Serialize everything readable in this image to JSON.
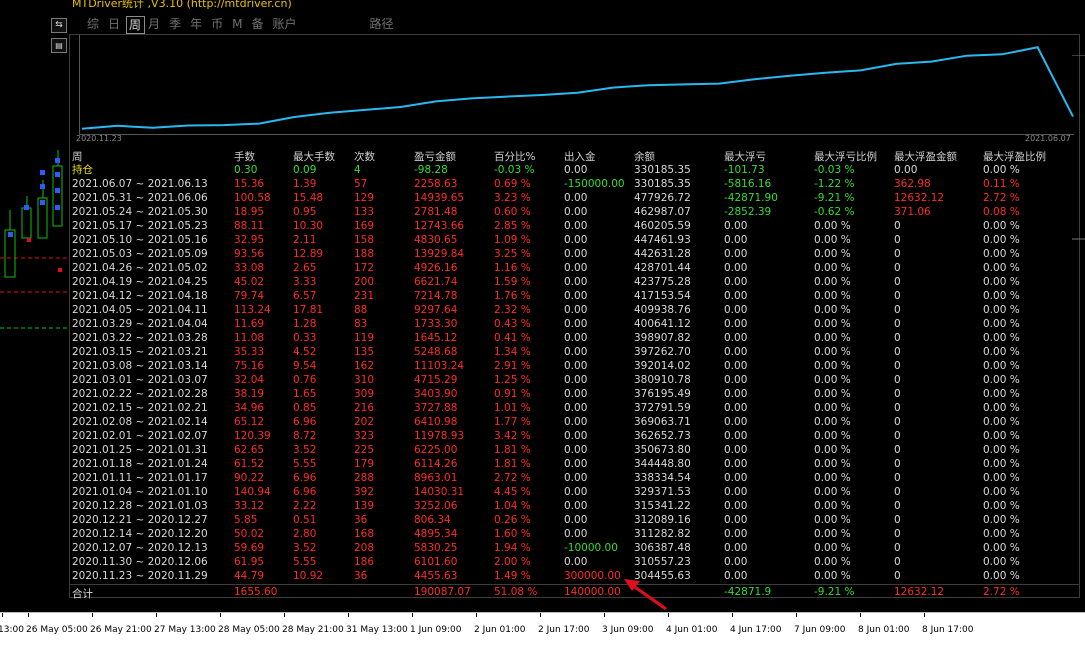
{
  "window": {
    "title": "MTDriver统计 ,V3.10 (http://mtdriver.cn)"
  },
  "side_buttons": [
    "⇆",
    "▤",
    "√"
  ],
  "tabs": [
    {
      "label": "综"
    },
    {
      "label": "日"
    },
    {
      "label": "周",
      "active": true
    },
    {
      "label": "月"
    },
    {
      "label": "季"
    },
    {
      "label": "年"
    },
    {
      "label": "币"
    },
    {
      "label": "M"
    },
    {
      "label": "备"
    },
    {
      "label": "账户"
    },
    {
      "label": "路径"
    }
  ],
  "equity_chart": {
    "start_date": "2020.11.23",
    "end_date": "2021.06.07",
    "line_color": "#2ab8f0",
    "balances": [
      304455.63,
      310557.23,
      306387.48,
      311282.82,
      312089.16,
      315341.22,
      329371.53,
      338334.54,
      344448.8,
      350673.8,
      362652.73,
      369063.71,
      372791.59,
      376195.49,
      380910.78,
      392014.02,
      397262.7,
      398907.82,
      400641.12,
      409938.76,
      417153.54,
      423775.28,
      428701.44,
      442631.28,
      447461.93,
      460205.59,
      462987.07,
      477926.72,
      330185.35
    ]
  },
  "table": {
    "headers": [
      "周",
      "手数",
      "最大手数",
      "次数",
      "盈亏金额",
      "百分比%",
      "出入金",
      "余额",
      "最大浮亏",
      "最大浮亏比例",
      "最大浮盈金额",
      "最大浮盈比例"
    ],
    "holding": {
      "label": "持仓",
      "cells": [
        {
          "v": "0.30",
          "c": "g"
        },
        {
          "v": "0.09",
          "c": "g"
        },
        {
          "v": "4",
          "c": "g"
        },
        {
          "v": "-98.28",
          "c": "g"
        },
        {
          "v": "-0.03 %",
          "c": "g"
        },
        {
          "v": "0.00",
          "c": "w"
        },
        {
          "v": "330185.35",
          "c": "w"
        },
        {
          "v": "-101.73",
          "c": "g"
        },
        {
          "v": "-0.03 %",
          "c": "g"
        },
        {
          "v": "0.00",
          "c": "w"
        },
        {
          "v": "0.00 %",
          "c": "w"
        }
      ]
    },
    "rows": [
      [
        "2021.06.07 ~ 2021.06.13",
        "15.36",
        "1.39",
        "57",
        "2258.63",
        "0.69 %",
        "-150000.00",
        "330185.35",
        "-5816.16",
        "-1.22 %",
        "362.98",
        "0.11 %"
      ],
      [
        "2021.05.31 ~ 2021.06.06",
        "100.58",
        "15.48",
        "129",
        "14939.65",
        "3.23 %",
        "0.00",
        "477926.72",
        "-42871.90",
        "-9.21 %",
        "12632.12",
        "2.72 %"
      ],
      [
        "2021.05.24 ~ 2021.05.30",
        "18.95",
        "0.95",
        "133",
        "2781.48",
        "0.60 %",
        "0.00",
        "462987.07",
        "-2852.39",
        "-0.62 %",
        "371.06",
        "0.08 %"
      ],
      [
        "2021.05.17 ~ 2021.05.23",
        "88.11",
        "10.30",
        "169",
        "12743.66",
        "2.85 %",
        "0.00",
        "460205.59",
        "0.00",
        "0.00 %",
        "0",
        "0.00 %"
      ],
      [
        "2021.05.10 ~ 2021.05.16",
        "32.95",
        "2.11",
        "158",
        "4830.65",
        "1.09 %",
        "0.00",
        "447461.93",
        "0.00",
        "0.00 %",
        "0",
        "0.00 %"
      ],
      [
        "2021.05.03 ~ 2021.05.09",
        "93.56",
        "12.89",
        "188",
        "13929.84",
        "3.25 %",
        "0.00",
        "442631.28",
        "0.00",
        "0.00 %",
        "0",
        "0.00 %"
      ],
      [
        "2021.04.26 ~ 2021.05.02",
        "33.08",
        "2.65",
        "172",
        "4926.16",
        "1.16 %",
        "0.00",
        "428701.44",
        "0.00",
        "0.00 %",
        "0",
        "0.00 %"
      ],
      [
        "2021.04.19 ~ 2021.04.25",
        "45.02",
        "3.33",
        "200",
        "6621.74",
        "1.59 %",
        "0.00",
        "423775.28",
        "0.00",
        "0.00 %",
        "0",
        "0.00 %"
      ],
      [
        "2021.04.12 ~ 2021.04.18",
        "79.74",
        "6.57",
        "231",
        "7214.78",
        "1.76 %",
        "0.00",
        "417153.54",
        "0.00",
        "0.00 %",
        "0",
        "0.00 %"
      ],
      [
        "2021.04.05 ~ 2021.04.11",
        "113.24",
        "17.81",
        "88",
        "9297.64",
        "2.32 %",
        "0.00",
        "409938.76",
        "0.00",
        "0.00 %",
        "0",
        "0.00 %"
      ],
      [
        "2021.03.29 ~ 2021.04.04",
        "11.69",
        "1.28",
        "83",
        "1733.30",
        "0.43 %",
        "0.00",
        "400641.12",
        "0.00",
        "0.00 %",
        "0",
        "0.00 %"
      ],
      [
        "2021.03.22 ~ 2021.03.28",
        "11.08",
        "0.33",
        "119",
        "1645.12",
        "0.41 %",
        "0.00",
        "398907.82",
        "0.00",
        "0.00 %",
        "0",
        "0.00 %"
      ],
      [
        "2021.03.15 ~ 2021.03.21",
        "35.33",
        "4.52",
        "135",
        "5248.68",
        "1.34 %",
        "0.00",
        "397262.70",
        "0.00",
        "0.00 %",
        "0",
        "0.00 %"
      ],
      [
        "2021.03.08 ~ 2021.03.14",
        "75.16",
        "9.54",
        "162",
        "11103.24",
        "2.91 %",
        "0.00",
        "392014.02",
        "0.00",
        "0.00 %",
        "0",
        "0.00 %"
      ],
      [
        "2021.03.01 ~ 2021.03.07",
        "32.04",
        "0.76",
        "310",
        "4715.29",
        "1.25 %",
        "0.00",
        "380910.78",
        "0.00",
        "0.00 %",
        "0",
        "0.00 %"
      ],
      [
        "2021.02.22 ~ 2021.02.28",
        "38.19",
        "1.65",
        "309",
        "3403.90",
        "0.91 %",
        "0.00",
        "376195.49",
        "0.00",
        "0.00 %",
        "0",
        "0.00 %"
      ],
      [
        "2021.02.15 ~ 2021.02.21",
        "34.96",
        "0.85",
        "216",
        "3727.88",
        "1.01 %",
        "0.00",
        "372791.59",
        "0.00",
        "0.00 %",
        "0",
        "0.00 %"
      ],
      [
        "2021.02.08 ~ 2021.02.14",
        "65.12",
        "6.96",
        "202",
        "6410.98",
        "1.77 %",
        "0.00",
        "369063.71",
        "0.00",
        "0.00 %",
        "0",
        "0.00 %"
      ],
      [
        "2021.02.01 ~ 2021.02.07",
        "120.39",
        "8.72",
        "323",
        "11978.93",
        "3.42 %",
        "0.00",
        "362652.73",
        "0.00",
        "0.00 %",
        "0",
        "0.00 %"
      ],
      [
        "2021.01.25 ~ 2021.01.31",
        "62.65",
        "3.52",
        "225",
        "6225.00",
        "1.81 %",
        "0.00",
        "350673.80",
        "0.00",
        "0.00 %",
        "0",
        "0.00 %"
      ],
      [
        "2021.01.18 ~ 2021.01.24",
        "61.52",
        "5.55",
        "179",
        "6114.26",
        "1.81 %",
        "0.00",
        "344448.80",
        "0.00",
        "0.00 %",
        "0",
        "0.00 %"
      ],
      [
        "2021.01.11 ~ 2021.01.17",
        "90.22",
        "6.96",
        "288",
        "8963.01",
        "2.72 %",
        "0.00",
        "338334.54",
        "0.00",
        "0.00 %",
        "0",
        "0.00 %"
      ],
      [
        "2021.01.04 ~ 2021.01.10",
        "140.94",
        "6.96",
        "392",
        "14030.31",
        "4.45 %",
        "0.00",
        "329371.53",
        "0.00",
        "0.00 %",
        "0",
        "0.00 %"
      ],
      [
        "2020.12.28 ~ 2021.01.03",
        "33.12",
        "2.22",
        "139",
        "3252.06",
        "1.04 %",
        "0.00",
        "315341.22",
        "0.00",
        "0.00 %",
        "0",
        "0.00 %"
      ],
      [
        "2020.12.21 ~ 2020.12.27",
        "5.85",
        "0.51",
        "36",
        "806.34",
        "0.26 %",
        "0.00",
        "312089.16",
        "0.00",
        "0.00 %",
        "0",
        "0.00 %"
      ],
      [
        "2020.12.14 ~ 2020.12.20",
        "50.02",
        "2.80",
        "168",
        "4895.34",
        "1.60 %",
        "0.00",
        "311282.82",
        "0.00",
        "0.00 %",
        "0",
        "0.00 %"
      ],
      [
        "2020.12.07 ~ 2020.12.13",
        "59.69",
        "3.52",
        "208",
        "5830.25",
        "1.94 %",
        "-10000.00",
        "306387.48",
        "0.00",
        "0.00 %",
        "0",
        "0.00 %"
      ],
      [
        "2020.11.30 ~ 2020.12.06",
        "61.95",
        "5.55",
        "186",
        "6101.60",
        "2.00 %",
        "0.00",
        "310557.23",
        "0.00",
        "0.00 %",
        "0",
        "0.00 %"
      ],
      [
        "2020.11.23 ~ 2020.11.29",
        "44.79",
        "10.92",
        "36",
        "4455.63",
        "1.49 %",
        "300000.00",
        "304455.63",
        "0.00",
        "0.00 %",
        "0",
        "0.00 %"
      ]
    ],
    "totals": {
      "label": "合计",
      "lots": "1655.60",
      "pnl": "190087.07",
      "pct": "51.08 %",
      "deposit": "140000.00",
      "max_float_loss": "-42871.9",
      "max_float_loss_pct": "-9.21 %",
      "max_float_profit": "12632.12",
      "max_float_profit_pct": "2.72 %"
    }
  },
  "time_axis": [
    "13:00",
    "26 May 05:00",
    "26 May 21:00",
    "27 May 13:00",
    "28 May 05:00",
    "28 May 21:00",
    "31 May 13:00",
    "1 Jun 09:00",
    "2 Jun 01:00",
    "2 Jun 17:00",
    "3 Jun 09:00",
    "4 Jun 01:00",
    "4 Jun 17:00",
    "7 Jun 09:00",
    "8 Jun 01:00",
    "8 Jun 17:00"
  ],
  "colors": {
    "profit": "#ff2a2a",
    "loss": "#33dd33",
    "text": "#d8d8d8",
    "equity": "#2ab8f0",
    "arrow": "#e0101a"
  }
}
